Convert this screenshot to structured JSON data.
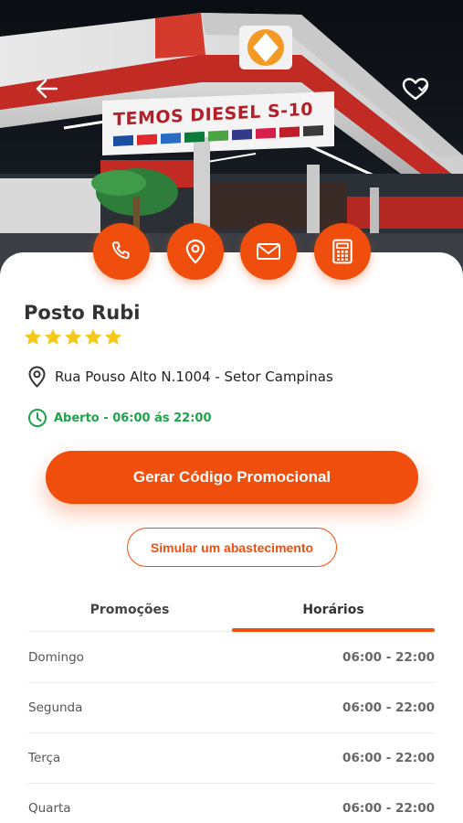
{
  "hero": {
    "sign_text": "TEMOS DIESEL S-10"
  },
  "contact_actions": [
    {
      "name": "phone",
      "icon": "phone-icon"
    },
    {
      "name": "location",
      "icon": "map-pin-icon"
    },
    {
      "name": "email",
      "icon": "mail-icon"
    },
    {
      "name": "calculator",
      "icon": "calculator-icon"
    }
  ],
  "station": {
    "name": "Posto Rubi",
    "rating": 5,
    "address": "Rua Pouso Alto N.1004 - Setor Campinas",
    "status": "Aberto - 06:00 ás 22:00"
  },
  "actions": {
    "promo_button": "Gerar Código Promocional",
    "simulate_button": "Simular um abastecimento"
  },
  "tabs": [
    {
      "label": "Promoções",
      "active": false
    },
    {
      "label": "Horários",
      "active": true
    }
  ],
  "schedule": [
    {
      "day": "Domingo",
      "hours": "06:00 - 22:00"
    },
    {
      "day": "Segunda",
      "hours": "06:00 - 22:00"
    },
    {
      "day": "Terça",
      "hours": "06:00 - 22:00"
    },
    {
      "day": "Quarta",
      "hours": "06:00 - 22:00"
    }
  ],
  "colors": {
    "accent": "#f04e0c",
    "open_status": "#1fa34a",
    "star": "#f6c81a"
  }
}
